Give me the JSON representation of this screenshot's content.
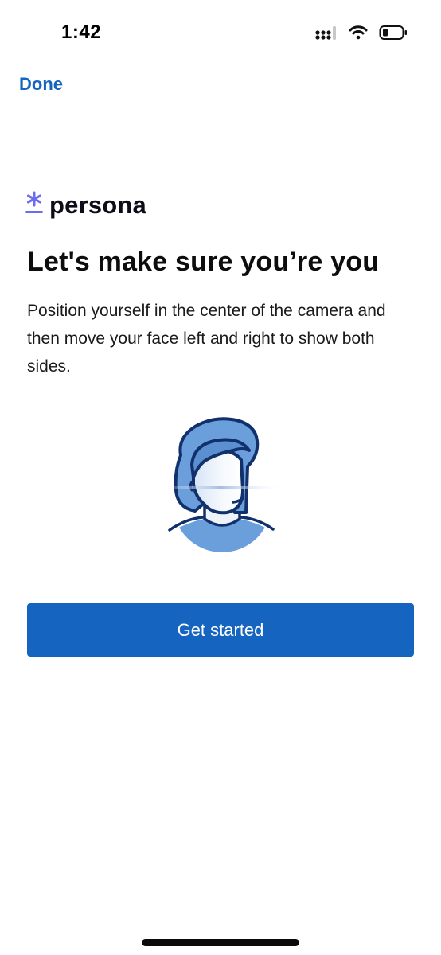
{
  "status_bar": {
    "time": "1:42",
    "icons": [
      "cellular-signal-icon",
      "wifi-icon",
      "battery-icon"
    ]
  },
  "nav": {
    "done_label": "Done"
  },
  "logo": {
    "wordmark": "persona",
    "icon": "asterisk-logo-icon",
    "accent_color": "#6B6CF0"
  },
  "content": {
    "title": "Let's make sure you’re you",
    "description": "Position yourself in the center of the camera and then move your face left and right to show both sides.",
    "illustration_icon": "face-scan-illustration"
  },
  "actions": {
    "get_started_label": "Get started"
  },
  "colors": {
    "primary": "#1565C0",
    "illustration_blue": "#6A9FDC",
    "illustration_outline": "#12306B"
  }
}
